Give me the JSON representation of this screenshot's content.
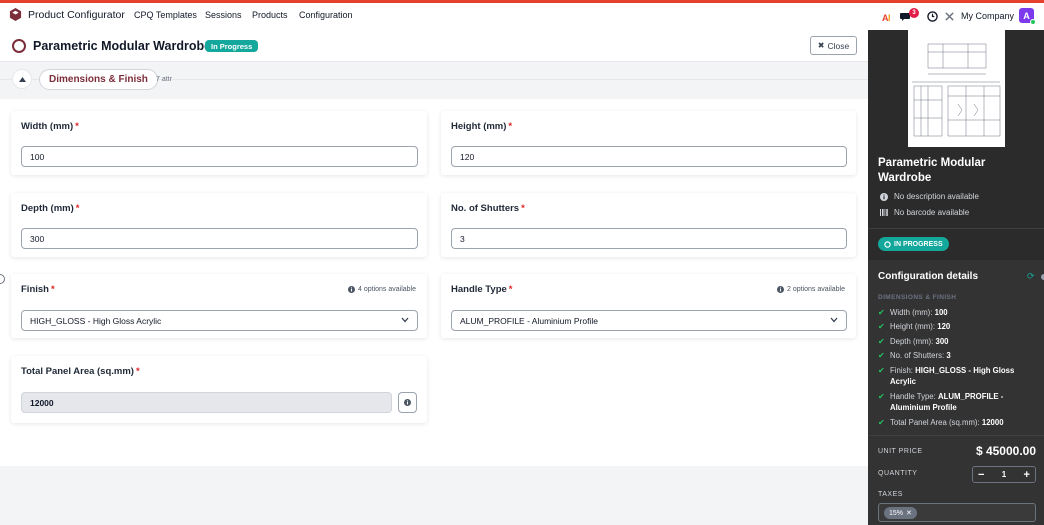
{
  "app": {
    "title": "Product Configurator",
    "company": "My Company",
    "user_initial": "A",
    "notifications_count": "3"
  },
  "nav": {
    "items": [
      "CPQ Templates",
      "Sessions",
      "Products",
      "Configuration"
    ]
  },
  "header": {
    "title": "Parametric Modular Wardrobe",
    "status": "In Progress",
    "close_label": "Close"
  },
  "section": {
    "name": "Dimensions & Finish",
    "count": "7 attr"
  },
  "fields": {
    "width": {
      "label": "Width (mm)",
      "value": "100"
    },
    "height": {
      "label": "Height (mm)",
      "value": "120"
    },
    "depth": {
      "label": "Depth (mm)",
      "value": "300"
    },
    "shutters": {
      "label": "No. of Shutters",
      "value": "3"
    },
    "finish": {
      "label": "Finish",
      "hint": "4 options available",
      "value": "HIGH_GLOSS - High Gloss Acrylic"
    },
    "handle": {
      "label": "Handle Type",
      "hint": "2 options available",
      "value": "ALUM_PROFILE - Aluminium Profile"
    },
    "area": {
      "label": "Total Panel Area (sq.mm)",
      "value": "12000"
    }
  },
  "sidebar": {
    "product_title": "Parametric Modular Wardrobe",
    "no_description": "No description available",
    "no_barcode": "No barcode available",
    "status": "IN PROGRESS",
    "config_title": "Configuration details",
    "group": "DIMENSIONS & FINISH",
    "items": [
      {
        "label": "Width (mm):",
        "value": "100"
      },
      {
        "label": "Height (mm):",
        "value": "120"
      },
      {
        "label": "Depth (mm):",
        "value": "300"
      },
      {
        "label": "No. of Shutters:",
        "value": "3"
      },
      {
        "label": "Finish:",
        "value": "HIGH_GLOSS - High Gloss Acrylic"
      },
      {
        "label": "Handle Type:",
        "value": "ALUM_PROFILE - Aluminium Profile"
      },
      {
        "label": "Total Panel Area (sq.mm):",
        "value": "12000"
      }
    ],
    "unit_price_label": "UNIT PRICE",
    "unit_price": "$ 45000.00",
    "quantity_label": "QUANTITY",
    "quantity": "1",
    "taxes_label": "TAXES",
    "tax_tag": "15%"
  },
  "colors": {
    "accent": "#7c2d3a",
    "status": "#14a89c",
    "required": "#dc2626",
    "sidebar_bg": "#2b2b2b"
  }
}
